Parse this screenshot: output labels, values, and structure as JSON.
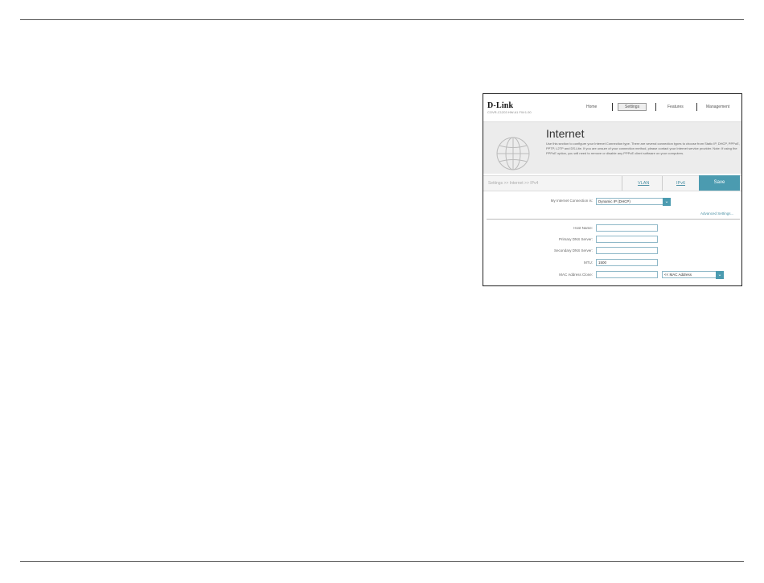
{
  "header": {
    "logo": "D-Link",
    "model": "COVR-C1203 HW:A1 FW:1.00",
    "nav": [
      "Home",
      "Settings",
      "Features",
      "Management"
    ]
  },
  "banner": {
    "title": "Internet",
    "description": "Use this section to configure your Internet Connection type. There are several connection types to choose from Static IP, DHCP, PPPoE, PPTP, L2TP and DS-Lite. If you are unsure of your connection method, please contact your Internet service provider. Note: If using the PPPoE option, you will need to remove or disable any PPPoE client software on your computers."
  },
  "breadcrumb": "Settings >> Internet >> IPv4",
  "tabs": {
    "vlan": "VLAN",
    "ipv6": "IPv6"
  },
  "save_label": "Save",
  "form": {
    "connection_label": "My Internet Connection is:",
    "connection_value": "Dynamic IP (DHCP)",
    "advanced_link": "Advanced Settings...",
    "host_name_label": "Host Name:",
    "host_name_value": "",
    "primary_dns_label": "Primary DNS Server:",
    "primary_dns_value": "",
    "secondary_dns_label": "Secondary DNS Server:",
    "secondary_dns_value": "",
    "mtu_label": "MTU:",
    "mtu_value": "1500",
    "mac_clone_label": "MAC Address Clone:",
    "mac_clone_value": "",
    "mac_select_value": "<< MAC Address"
  },
  "icons": {
    "dropdown": "chevron-down-icon",
    "globe": "globe-icon"
  },
  "colors": {
    "accent": "#4b9bb0",
    "link": "#4a90a4"
  }
}
